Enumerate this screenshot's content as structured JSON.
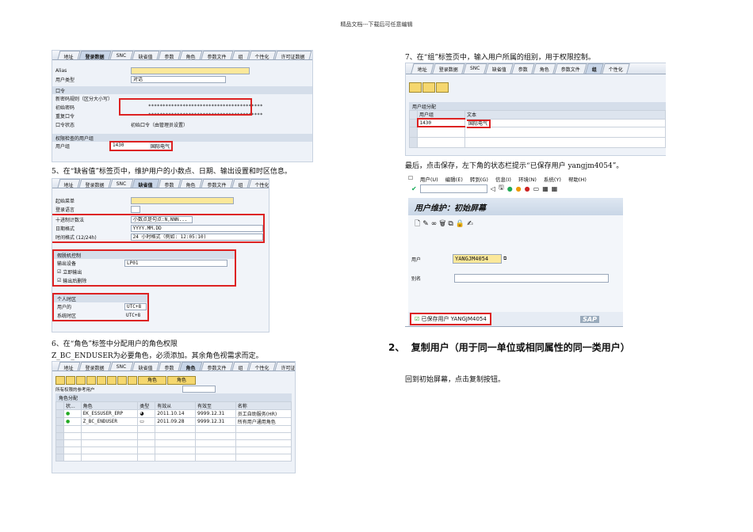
{
  "header": "精品文档---下载后可任意编辑",
  "tabs": [
    "地址",
    "登录数据",
    "SNC",
    "缺省值",
    "参数",
    "角色",
    "参数文件",
    "组",
    "个性化",
    "许可证数据"
  ],
  "shot1": {
    "alias_label": "Alias",
    "user_type_label": "用户类型",
    "user_type_value": "对话",
    "password_section": "口令",
    "password_rules": "新密码规则（区分大小写）",
    "initial_pw_label": "初始密码",
    "repeat_pw_label": "重复口令",
    "pw_value": "****************************************",
    "pw_status_label": "口令状态",
    "pw_status_value": "初始口令（由管理员设置）",
    "group_section": "权限检查的用户组",
    "group_label": "用户组",
    "group_value": "1430",
    "group_text": "国际电气"
  },
  "caption5": "5、在“缺省值”标签页中，维护用户的小数点、日期、输出设置和时区信息。",
  "shot2": {
    "start_menu": "起始菜单",
    "logon_lang": "登录语言",
    "decimal_label": "十进制计数法",
    "decimal_value": "小数点是句点:N,NNN...",
    "date_label": "日期格式",
    "date_value": "YYYY.MM.DD",
    "time_label": "时间格式 (12/24h)",
    "time_value": "24 小时格式（例如: 12:05:10)",
    "spool_section": "假脱机控制",
    "output_device_label": "输出设备",
    "output_device_value": "LP01",
    "print_now": "立即输出",
    "delete_after": "输出后删除",
    "tz_section": "个人时区",
    "user_tz_label": "用户的",
    "user_tz_value": "UTC+8",
    "sys_tz_label": "系统时区",
    "sys_tz_value": "UTC+8"
  },
  "caption6": "6、在“角色”标签中分配用户的角色权限",
  "caption6b": "Z_BC_ENDUSER为必要角色，必须添加。其余角色视需求而定。",
  "shot3": {
    "role_btn1": "角色",
    "role_btn2": "角色",
    "ref_user_label": "所有权限的参考用户",
    "section": "角色分配",
    "columns": [
      "状...",
      "角色",
      "类型",
      "有效从",
      "有效至",
      "名称"
    ],
    "rows": [
      {
        "role": "EK_ESSUSER_ERP",
        "from": "2011.10.14",
        "to": "9999.12.31",
        "name": "员工自助服务(HR)"
      },
      {
        "role": "Z_BC_ENDUSER",
        "from": "2011.09.28",
        "to": "9999.12.31",
        "name": "所有用户通用角色"
      }
    ]
  },
  "caption7": "7、在“组”标签页中，输入用户所属的组别，用于权限控制。",
  "shot4": {
    "section": "用户组分配",
    "columns": [
      "用户组",
      "文本"
    ],
    "rows": [
      {
        "group": "1430",
        "text": "国际电气"
      }
    ]
  },
  "caption_save": "最后，点击保存，左下角的状态栏提示“已保存用户 yangjm4054”。",
  "shot5": {
    "menu": [
      "用户(U)",
      "编辑(E)",
      "转到(G)",
      "信息(I)",
      "环境(N)",
      "系统(Y)",
      "帮助(H)"
    ],
    "title": "用户维护：初始屏幕",
    "user_label": "用户",
    "user_value": "YANGJM4054",
    "alias_label": "别名",
    "status": "已保存用户 YANGJM4054",
    "logo": "SAP"
  },
  "section2_num": "2、",
  "section2_title": "复制用户（用于同一单位或相同属性的同一类用户）",
  "section2_text": "回到初始屏幕，点击复制按钮。"
}
